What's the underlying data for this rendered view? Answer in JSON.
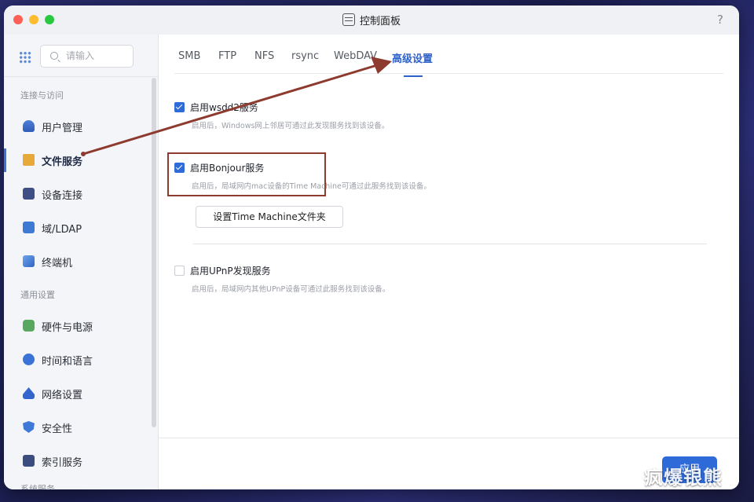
{
  "window": {
    "title": "控制面板",
    "help": "?"
  },
  "search": {
    "placeholder": "请输入"
  },
  "sidebar": {
    "groups": [
      {
        "label": "连接与访问"
      },
      {
        "label": "通用设置"
      },
      {
        "label": "系统服务"
      }
    ],
    "items": [
      {
        "label": "用户管理",
        "icon": "user-icon"
      },
      {
        "label": "文件服务",
        "icon": "folder-icon",
        "active": true
      },
      {
        "label": "设备连接",
        "icon": "device-icon"
      },
      {
        "label": "域/LDAP",
        "icon": "ldap-icon"
      },
      {
        "label": "终端机",
        "icon": "terminal-icon"
      },
      {
        "label": "硬件与电源",
        "icon": "power-icon"
      },
      {
        "label": "时间和语言",
        "icon": "clock-icon"
      },
      {
        "label": "网络设置",
        "icon": "network-icon"
      },
      {
        "label": "安全性",
        "icon": "shield-icon"
      },
      {
        "label": "索引服务",
        "icon": "index-icon"
      }
    ]
  },
  "tabs": [
    {
      "label": "SMB"
    },
    {
      "label": "FTP"
    },
    {
      "label": "NFS"
    },
    {
      "label": "rsync"
    },
    {
      "label": "WebDAV"
    },
    {
      "label": "高级设置",
      "active": true
    }
  ],
  "options": [
    {
      "label": "启用wsdd2服务",
      "desc": "启用后，Windows网上邻居可通过此发现服务找到该设备。",
      "checked": true
    },
    {
      "label": "启用Bonjour服务",
      "desc": "启用后，局域网内mac设备的Time Machine可通过此服务找到该设备。",
      "checked": true
    },
    {
      "label": "启用UPnP发现服务",
      "desc": "启用后，局域网内其他UPnP设备可通过此服务找到该设备。",
      "checked": false
    }
  ],
  "time_machine_button": "设置Time Machine文件夹",
  "apply_button": "应用",
  "watermark": "疯爆银熊",
  "colors": {
    "accent": "#2f6bd8",
    "annotation": "#8d3a2f"
  }
}
